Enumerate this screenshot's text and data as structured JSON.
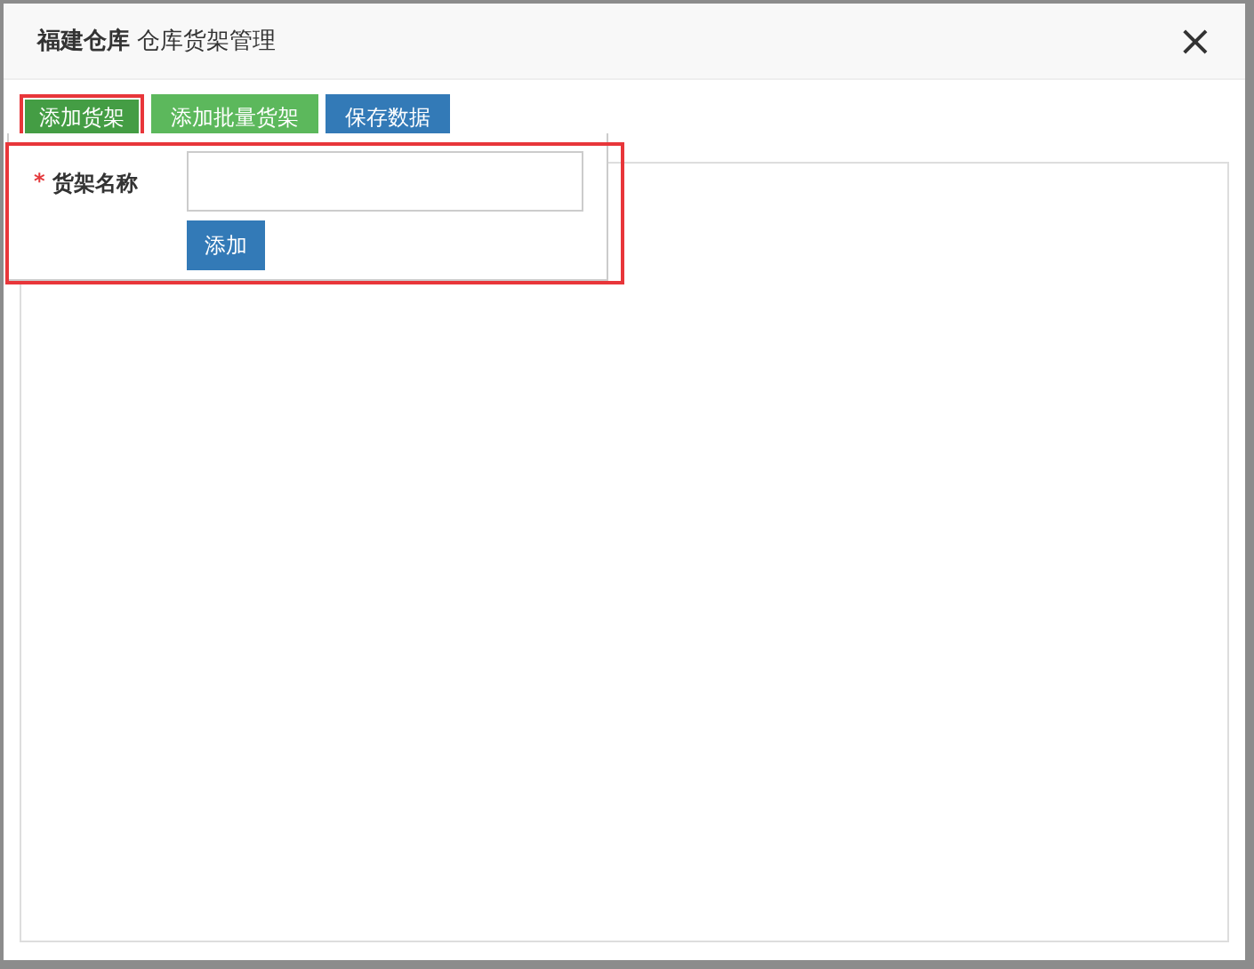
{
  "dialog": {
    "title": "**福建仓库** 仓库货架管理",
    "close": "×"
  },
  "toolbar": [
    {
      "label": "添加货架",
      "kind": "dark-green",
      "focused": true
    },
    {
      "label": "添加批量货架",
      "kind": "green",
      "focused": false
    },
    {
      "label": "保存数据",
      "kind": "blue",
      "focused": false
    }
  ],
  "popup": {
    "highlighted": true,
    "field": {
      "label": "货架名称",
      "required_mark": "*"
    },
    "button": "添加"
  }
}
